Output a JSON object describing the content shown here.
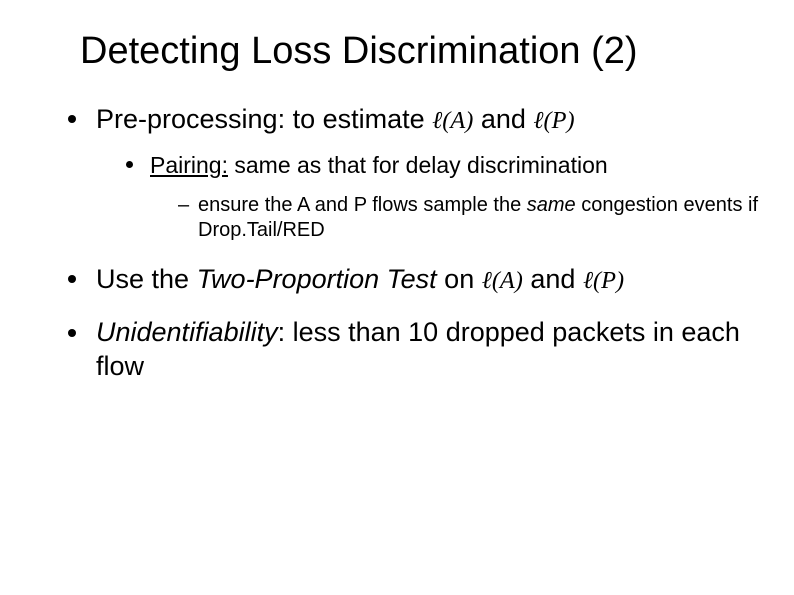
{
  "title": "Detecting Loss Discrimination (2)",
  "b1": {
    "pre": "Pre-processing: to estimate ",
    "mathA": "ℓ(A)",
    "and": " and ",
    "mathP": "ℓ(P)",
    "sub": {
      "pairing_u": "Pairing:",
      "pairing_rest": " same as that for delay discrimination",
      "ensure_a": "ensure the ",
      "ensure_b": "A",
      "ensure_c": " and ",
      "ensure_d": "P",
      "ensure_e": " flows sample the ",
      "ensure_f": "same",
      "ensure_g": " congestion events if Drop.Tail/RED"
    }
  },
  "b2": {
    "a": "Use the ",
    "b": "Two-Proportion Test",
    "c": " on ",
    "mathA": "ℓ(A)",
    "and": " and ",
    "mathP": "ℓ(P)"
  },
  "b3": {
    "a": "Unidentifiability",
    "b": ": less than 10 dropped packets in each flow"
  }
}
